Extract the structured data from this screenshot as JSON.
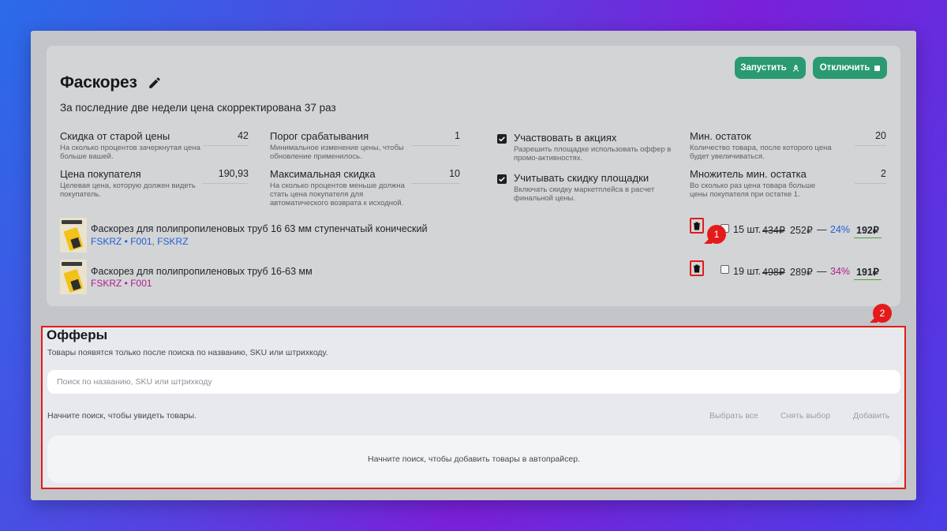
{
  "product_card": {
    "title": "Фаскорез",
    "subtitle": "За последние две недели цена скорректирована 37 раз",
    "buttons": {
      "start": "Запустить",
      "stop": "Отключить"
    }
  },
  "params": {
    "old_price_discount": {
      "label": "Скидка от старой цены",
      "hint": "На сколько процентов зачеркнутая цена больше вашей.",
      "value": "42"
    },
    "buyer_price": {
      "label": "Цена покупателя",
      "hint": "Целевая цена, которую должен видеть покупатель.",
      "value": "190,93"
    },
    "threshold": {
      "label": "Порог срабатывания",
      "hint": "Минимальное изменение цены, чтобы обновление применилось.",
      "value": "1"
    },
    "max_discount": {
      "label": "Максимальная скидка",
      "hint": "На сколько процентов меньше должна стать цена покупателя для автоматического возврата к исходной.",
      "value": "10"
    },
    "promo": {
      "label": "Участвовать в акциях",
      "hint": "Разрешить площадке использовать оффер в промо-активностях.",
      "checked": true
    },
    "marketplace_discount": {
      "label": "Учитывать скидку площадки",
      "hint": "Включать скидку маркетплейса в расчет финальной цены.",
      "checked": true
    },
    "min_stock": {
      "label": "Мин. остаток",
      "hint": "Количество товара, после которого цена будет увеличиваться.",
      "value": "20"
    },
    "min_stock_multiplier": {
      "label": "Множитель мин. остатка",
      "hint": "Во сколько раз цена товара больше цены покупателя при остатке 1.",
      "value": "2"
    }
  },
  "products": [
    {
      "thumb_text": "Фаскорез",
      "name": "Фаскорез для полипропиленовых труб 16 63 мм ступенчатый конический",
      "sku": "FSKRZ • F001, FSKRZ",
      "sku_color": "#1f5fd6",
      "qty": "15 шт.",
      "old_price": "434₽",
      "price": "252₽",
      "dash": "—",
      "pct": "24%",
      "pct_color": "#1f5fd6",
      "final": "192₽"
    },
    {
      "thumb_text": "Фаскорез",
      "name": "Фаскорез для полипропиленовых труб 16-63 мм",
      "sku": "FSKRZ • F001",
      "sku_color": "#b0208c",
      "qty": "19 шт.",
      "old_price": "498₽",
      "price": "289₽",
      "dash": "—",
      "pct": "34%",
      "pct_color": "#b0208c",
      "final": "191₽"
    }
  ],
  "annotations": {
    "badge1": "1",
    "badge2": "2"
  },
  "offers": {
    "title": "Офферы",
    "description": "Товары появятся только после поиска по названию, SKU или штрихкоду.",
    "search_placeholder": "Поиск по названию, SKU или штрихкоду",
    "start_hint": "Начните поиск, чтобы увидеть товары.",
    "actions": {
      "select_all": "Выбрать все",
      "clear": "Снять выбор",
      "add": "Добавить"
    },
    "empty_message": "Начните поиск, чтобы добавить товары в автопрайсер."
  },
  "colors": {
    "accent_green": "#2a9a72",
    "annotation_red": "#e41b1b"
  },
  "icons": {
    "edit": "pencil-icon",
    "start": "rocket-icon",
    "stop": "stop-icon",
    "delete": "trash-icon",
    "check": "checkmark-icon"
  }
}
